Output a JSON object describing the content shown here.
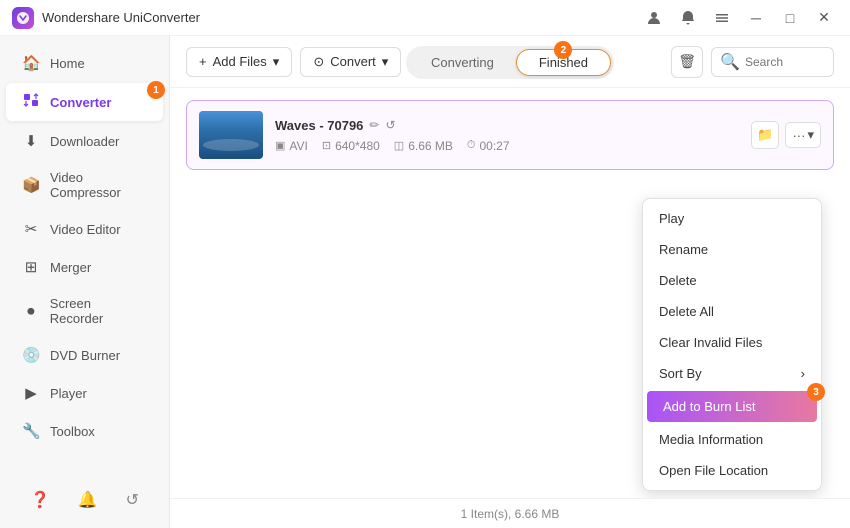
{
  "app": {
    "title": "Wondershare UniConverter",
    "logo": "W"
  },
  "titlebar": {
    "controls": [
      "minimize",
      "maximize",
      "close"
    ],
    "icons": [
      "user-icon",
      "bell-icon",
      "menu-icon",
      "minimize-icon",
      "maximize-icon",
      "close-icon"
    ]
  },
  "sidebar": {
    "items": [
      {
        "id": "home",
        "label": "Home",
        "icon": "🏠"
      },
      {
        "id": "converter",
        "label": "Converter",
        "icon": "🔄",
        "active": true,
        "badge": "1"
      },
      {
        "id": "downloader",
        "label": "Downloader",
        "icon": "⬇"
      },
      {
        "id": "video-compressor",
        "label": "Video Compressor",
        "icon": "📦"
      },
      {
        "id": "video-editor",
        "label": "Video Editor",
        "icon": "✂"
      },
      {
        "id": "merger",
        "label": "Merger",
        "icon": "⊞"
      },
      {
        "id": "screen-recorder",
        "label": "Screen Recorder",
        "icon": "⏺"
      },
      {
        "id": "dvd-burner",
        "label": "DVD Burner",
        "icon": "💿"
      },
      {
        "id": "player",
        "label": "Player",
        "icon": "▶"
      },
      {
        "id": "toolbox",
        "label": "Toolbox",
        "icon": "🔧"
      }
    ],
    "bottom": [
      "help-icon",
      "notification-icon",
      "refresh-icon"
    ]
  },
  "toolbar": {
    "add_button": "+ Add Files",
    "convert_button": "⊙ Convert",
    "tabs": [
      {
        "id": "converting",
        "label": "Converting",
        "active": false
      },
      {
        "id": "finished",
        "label": "Finished",
        "active": true
      }
    ],
    "finished_badge": "2",
    "search_placeholder": "Search"
  },
  "files": [
    {
      "name": "Waves - 70796",
      "format": "AVI",
      "resolution": "640*480",
      "size": "6.66 MB",
      "duration": "00:27"
    }
  ],
  "context_menu": {
    "items": [
      {
        "id": "play",
        "label": "Play",
        "highlighted": false
      },
      {
        "id": "rename",
        "label": "Rename",
        "highlighted": false
      },
      {
        "id": "delete",
        "label": "Delete",
        "highlighted": false
      },
      {
        "id": "delete-all",
        "label": "Delete All",
        "highlighted": false
      },
      {
        "id": "clear-invalid",
        "label": "Clear Invalid Files",
        "highlighted": false
      },
      {
        "id": "sort-by",
        "label": "Sort By",
        "highlighted": false,
        "has_arrow": true
      },
      {
        "id": "add-to-burn-list",
        "label": "Add to Burn List",
        "highlighted": true,
        "badge": "3"
      },
      {
        "id": "media-information",
        "label": "Media Information",
        "highlighted": false
      },
      {
        "id": "open-file-location",
        "label": "Open File Location",
        "highlighted": false
      }
    ]
  },
  "statusbar": {
    "text": "1 Item(s), 6.66 MB"
  }
}
